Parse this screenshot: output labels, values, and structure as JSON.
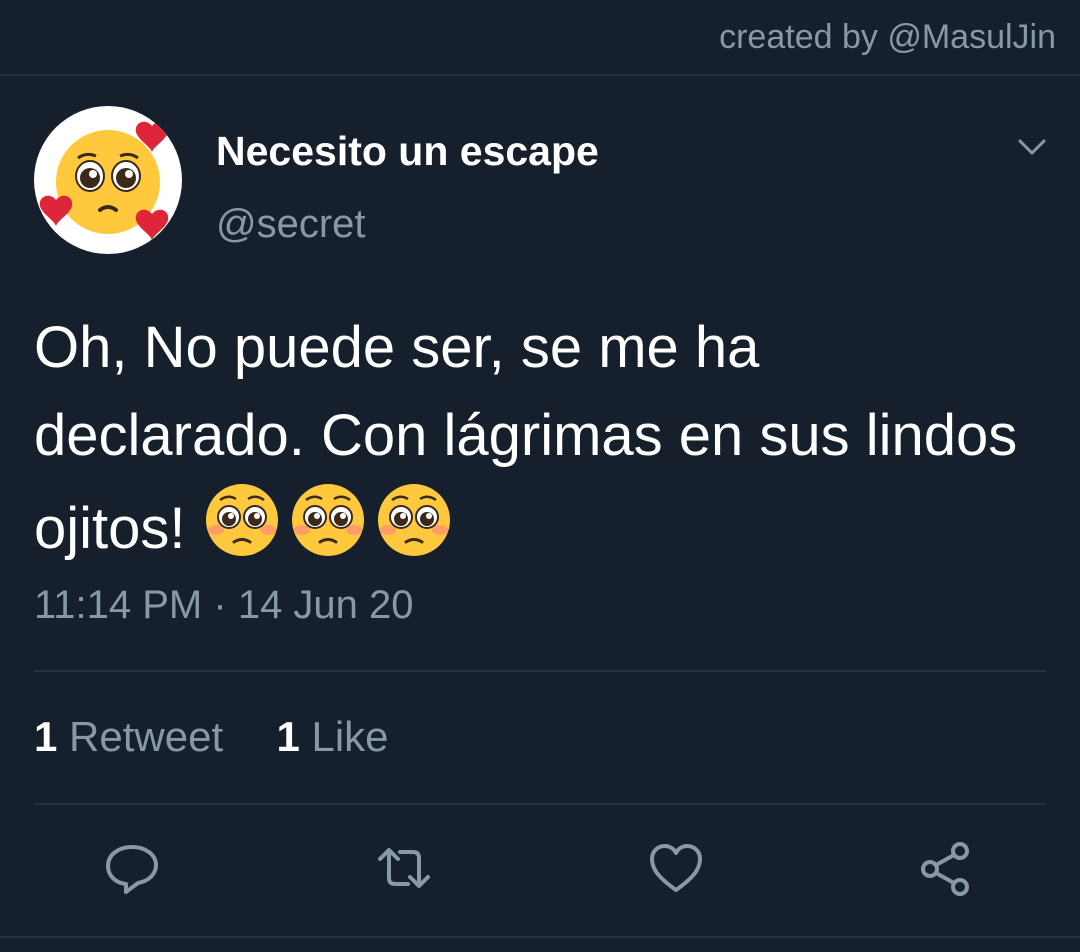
{
  "credit": "created by @MasulJin",
  "author": {
    "display_name": "Necesito un escape",
    "handle": "@secret",
    "avatar_icon": "pleading-face-hearts-icon"
  },
  "tweet": {
    "text": "Oh, No puede ser, se me ha declarado. Con lágrimas en sus lindos ojitos!",
    "emojis": [
      "pleading-face-icon",
      "pleading-face-icon",
      "pleading-face-icon"
    ],
    "time": "11:14 PM",
    "separator": "·",
    "date": "14 Jun 20"
  },
  "stats": {
    "retweet_count": "1",
    "retweet_label": "Retweet",
    "like_count": "1",
    "like_label": "Like"
  },
  "actions": [
    "reply-icon",
    "retweet-icon",
    "like-icon",
    "share-icon"
  ],
  "colors": {
    "background": "#16202c",
    "secondary_text": "#8899a6",
    "divider": "#253341",
    "primary_text": "#ffffff"
  }
}
